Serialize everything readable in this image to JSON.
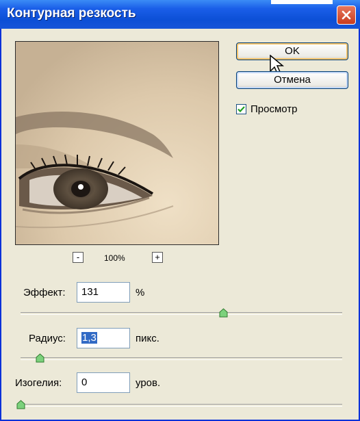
{
  "dialog": {
    "title": "Контурная резкость",
    "ok_label": "OK",
    "cancel_label": "Отмена",
    "preview_label": "Просмотр",
    "preview_checked": true,
    "zoom_out": "-",
    "zoom_in": "+",
    "zoom": "100%"
  },
  "params": {
    "effect": {
      "label": "Эффект:",
      "value": "131",
      "unit": "%",
      "slider_fraction": 0.63
    },
    "radius": {
      "label": "Радиус:",
      "value": "1,3",
      "unit": "пикс.",
      "slider_fraction": 0.06
    },
    "threshold": {
      "label": "Изогелия:",
      "value": "0",
      "unit": "уров.",
      "slider_fraction": 0.0
    }
  },
  "colors": {
    "titlebar": "#0c4fd6",
    "face": "#ece9d8",
    "selection": "#316ac5",
    "slider_thumb": "#5fbf5f"
  },
  "icons": [
    "close-icon",
    "checkmark-icon",
    "mouse-cursor-icon"
  ]
}
